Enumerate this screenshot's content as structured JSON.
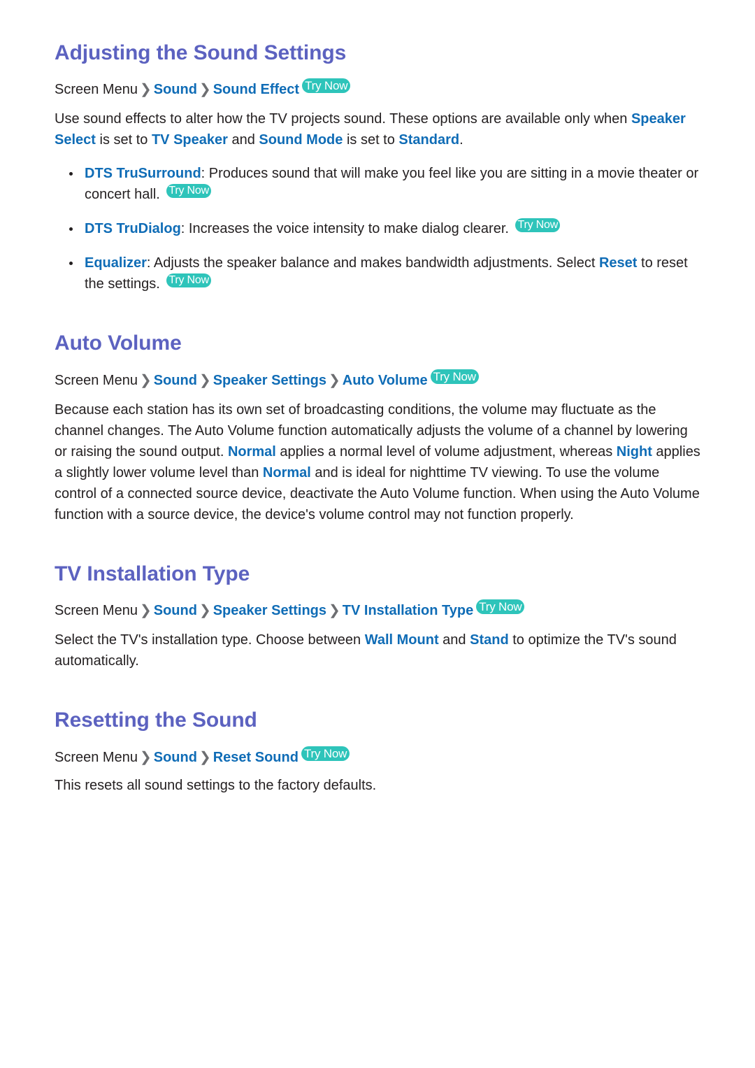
{
  "document": {
    "background_color": "#ffffff",
    "heading_color": "#5c62c0",
    "link_color": "#0f6cb6",
    "body_color": "#231f20",
    "badge_color": "#2ec4ba",
    "badge_text_color": "#ffffff"
  },
  "badges": {
    "try_now": "Try Now"
  },
  "separator": "❯",
  "sections": [
    {
      "id": "adjusting-sound-settings",
      "title": "Adjusting the Sound Settings",
      "breadcrumb": {
        "root": "Screen Menu",
        "items": [
          "Sound",
          "Sound Effect"
        ]
      },
      "intro": {
        "t1": "Use sound effects to alter how the TV projects sound. These options are available only when ",
        "l1": "Speaker Select",
        "t2": " is set to ",
        "l2": "TV Speaker",
        "t3": " and ",
        "l3": "Sound Mode",
        "t4": " is set to ",
        "l4": "Standard",
        "t5": "."
      },
      "bullets": [
        {
          "term": "DTS TruSurround",
          "t1": ": Produces sound that will make you feel like you are sitting in a movie theater or concert hall. ",
          "badge": "Try Now"
        },
        {
          "term": "DTS TruDialog",
          "t1": ": Increases the voice intensity to make dialog clearer. ",
          "badge": "Try Now"
        },
        {
          "term": "Equalizer",
          "t1": ": Adjusts the speaker balance and makes bandwidth adjustments. Select ",
          "l1": "Reset",
          "t2": " to reset the settings. ",
          "badge": "Try Now"
        }
      ]
    },
    {
      "id": "auto-volume",
      "title": "Auto Volume",
      "breadcrumb": {
        "root": "Screen Menu",
        "items": [
          "Sound",
          "Speaker Settings",
          "Auto Volume"
        ]
      },
      "body": {
        "t1": "Because each station has its own set of broadcasting conditions, the volume may fluctuate as the channel changes. The Auto Volume function automatically adjusts the volume of a channel by lowering or raising the sound output. ",
        "l1": "Normal",
        "t2": " applies a normal level of volume adjustment, whereas ",
        "l2": "Night",
        "t3": " applies a slightly lower volume level than ",
        "l3": "Normal",
        "t4": " and is ideal for nighttime TV viewing. To use the volume control of a connected source device, deactivate the Auto Volume function. When using the Auto Volume function with a source device, the device's volume control may not function properly."
      }
    },
    {
      "id": "tv-installation-type",
      "title": "TV Installation Type",
      "breadcrumb": {
        "root": "Screen Menu",
        "items": [
          "Sound",
          "Speaker Settings",
          "TV Installation Type"
        ]
      },
      "body": {
        "t1": "Select the TV's installation type. Choose between ",
        "l1": "Wall Mount",
        "t2": " and ",
        "l2": "Stand",
        "t3": " to optimize the TV's sound automatically."
      }
    },
    {
      "id": "resetting-the-sound",
      "title": "Resetting the Sound",
      "breadcrumb": {
        "root": "Screen Menu",
        "items": [
          "Sound",
          "Reset Sound"
        ]
      },
      "body": {
        "t1": "This resets all sound settings to the factory defaults."
      }
    }
  ]
}
